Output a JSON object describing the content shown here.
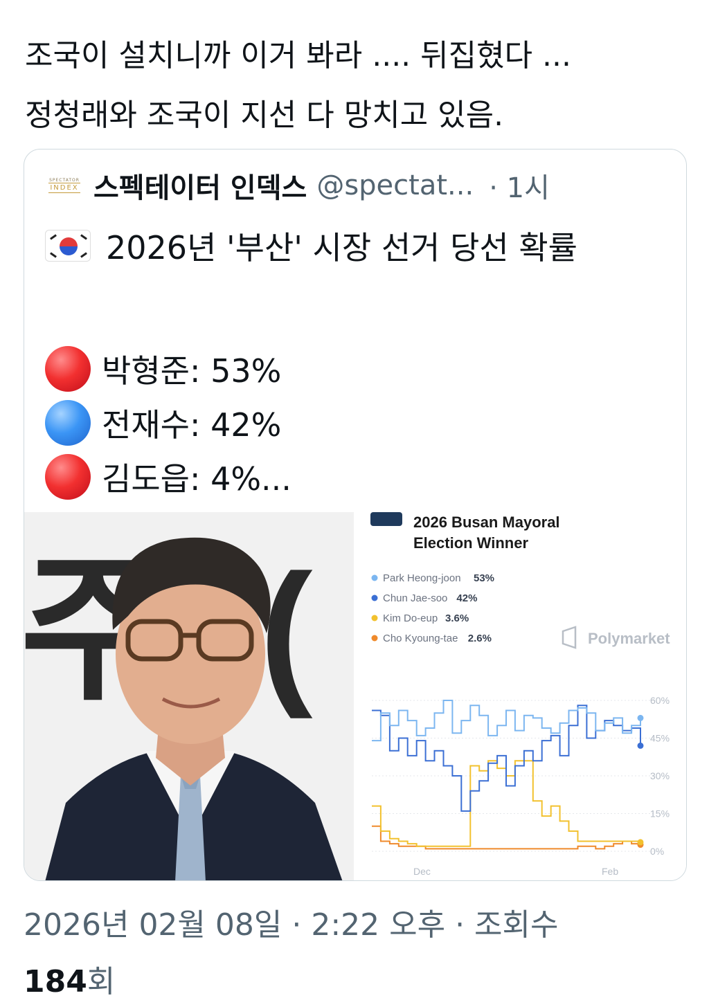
{
  "post": {
    "line1": "조국이 설치니까 이거 봐라 ....  뒤집혔다 ...",
    "line2": "정청래와 조국이 지선 다 망치고 있음."
  },
  "quote": {
    "account_name": "스펙테이터 인덱스",
    "handle": "@spectat...",
    "time": "· 1시",
    "logo_top": "SPECTATOR",
    "logo_bottom": "INDEX",
    "title": "2026년 '부산' 시장 선거 당선 확률",
    "candidates": [
      {
        "text": "박형준: 53%",
        "color": "red"
      },
      {
        "text": "전재수: 42%",
        "color": "blue"
      },
      {
        "text": "김도읍: 4%...",
        "color": "red"
      }
    ]
  },
  "photo_sign_text": "주+(",
  "chart_data": {
    "type": "line",
    "title": "2026 Busan Mayoral Election Winner",
    "brand": "Polymarket",
    "x_ticks": [
      "Dec",
      "Feb"
    ],
    "y_ticks": [
      "60%",
      "45%",
      "30%",
      "15%",
      "0%"
    ],
    "ylim": [
      0,
      60
    ],
    "grid": true,
    "legend_position": "top-left",
    "series": [
      {
        "name": "Park Heong-joon",
        "value_label": "53%",
        "color": "#7cb6f0",
        "values": [
          44,
          55,
          50,
          56,
          52,
          46,
          49,
          55,
          60,
          47,
          52,
          58,
          54,
          46,
          50,
          56,
          48,
          54,
          53,
          49,
          47,
          51,
          56,
          57,
          55,
          48,
          51,
          53,
          47,
          50,
          53
        ]
      },
      {
        "name": "Chun Jae-soo",
        "value_label": "42%",
        "color": "#3b6fd4",
        "values": [
          56,
          54,
          40,
          45,
          38,
          44,
          36,
          40,
          34,
          30,
          16,
          24,
          28,
          35,
          38,
          26,
          34,
          40,
          36,
          44,
          46,
          38,
          50,
          58,
          45,
          48,
          52,
          50,
          48,
          49,
          42
        ]
      },
      {
        "name": "Kim Do-eup",
        "value_label": "3.6%",
        "color": "#f2c12e",
        "values": [
          18,
          8,
          5,
          4,
          3,
          2,
          2,
          2,
          2,
          2,
          2,
          34,
          32,
          36,
          33,
          30,
          36,
          36,
          20,
          14,
          18,
          12,
          8,
          4,
          4,
          4,
          4,
          4,
          4,
          4,
          3.6
        ]
      },
      {
        "name": "Cho Kyoung-tae",
        "value_label": "2.6%",
        "color": "#ef8a2c",
        "values": [
          10,
          4,
          3,
          2,
          2,
          2,
          1,
          1,
          1,
          1,
          1,
          1,
          1,
          1,
          1,
          1,
          1,
          1,
          1,
          1,
          1,
          1,
          1,
          2,
          2,
          1,
          2,
          3,
          4,
          3,
          2.6
        ]
      }
    ]
  },
  "footer": {
    "timestamp": "2026년 02월 08일 · 2:22 오후 · 조회수",
    "views_num": "184",
    "views_unit": "회"
  }
}
